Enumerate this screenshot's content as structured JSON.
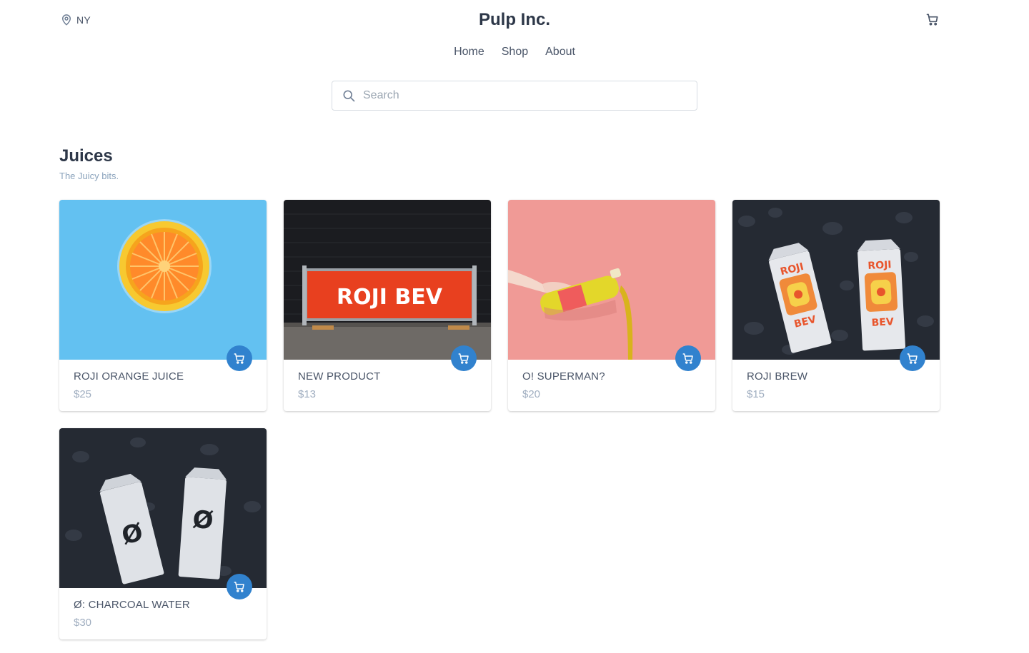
{
  "header": {
    "location": "NY",
    "brand": "Pulp Inc."
  },
  "nav": {
    "items": [
      "Home",
      "Shop",
      "About"
    ]
  },
  "search": {
    "placeholder": "Search"
  },
  "section": {
    "title": "Juices",
    "subtitle": "The Juicy bits."
  },
  "products": [
    {
      "name": "ROJI ORANGE JUICE",
      "price": "$25",
      "image_text": ""
    },
    {
      "name": "NEW PRODUCT",
      "price": "$13",
      "image_text": "ROJI BEV"
    },
    {
      "name": "O! SUPERMAN?",
      "price": "$20",
      "image_text": ""
    },
    {
      "name": "ROJI BREW",
      "price": "$15",
      "image_text": "ROJI BEV"
    },
    {
      "name": "Ø: CHARCOAL WATER",
      "price": "$30",
      "image_text": "Ø"
    }
  ],
  "colors": {
    "accent": "#3182ce",
    "text": "#4a5568",
    "muted": "#a0aec0"
  },
  "icons": {
    "location": "map-pin-icon",
    "cart": "shopping-cart-icon",
    "search": "search-icon"
  }
}
